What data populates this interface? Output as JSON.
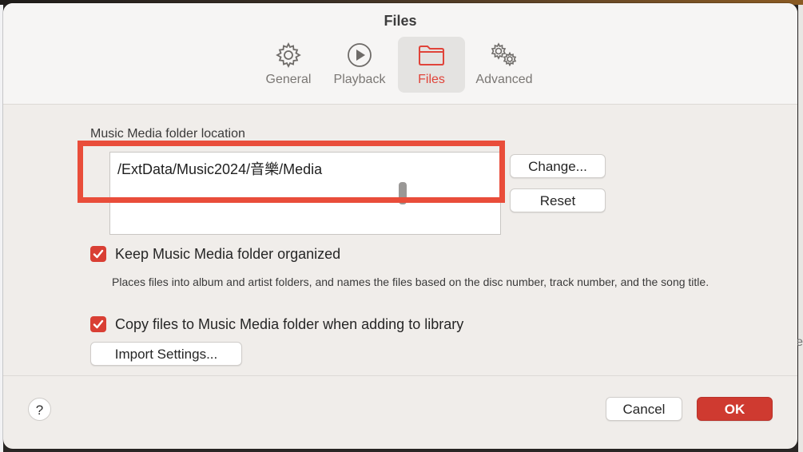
{
  "window": {
    "title": "Files"
  },
  "tabs": [
    {
      "label": "General",
      "icon": "gear-icon"
    },
    {
      "label": "Playback",
      "icon": "play-circle-icon"
    },
    {
      "label": "Files",
      "icon": "folder-icon",
      "active": true
    },
    {
      "label": "Advanced",
      "icon": "gears-icon"
    }
  ],
  "media_folder": {
    "label": "Music Media folder location",
    "path": "/ExtData/Music2024/音樂/Media",
    "change_button": "Change...",
    "reset_button": "Reset"
  },
  "options": {
    "keep_organized": {
      "label": "Keep Music Media folder organized",
      "checked": true,
      "description": "Places files into album and artist folders, and names the files based on the disc number, track number, and the song title."
    },
    "copy_files": {
      "label": "Copy files to Music Media folder when adding to library",
      "checked": true
    },
    "import_settings_button": "Import Settings..."
  },
  "footer": {
    "help": "?",
    "cancel_button": "Cancel",
    "ok_button": "OK"
  },
  "desktop": {
    "right_edge_letter": "e"
  },
  "colors": {
    "accent": "#d93f34",
    "highlight_border": "#e94d3a",
    "window_bg": "#f0edea"
  }
}
